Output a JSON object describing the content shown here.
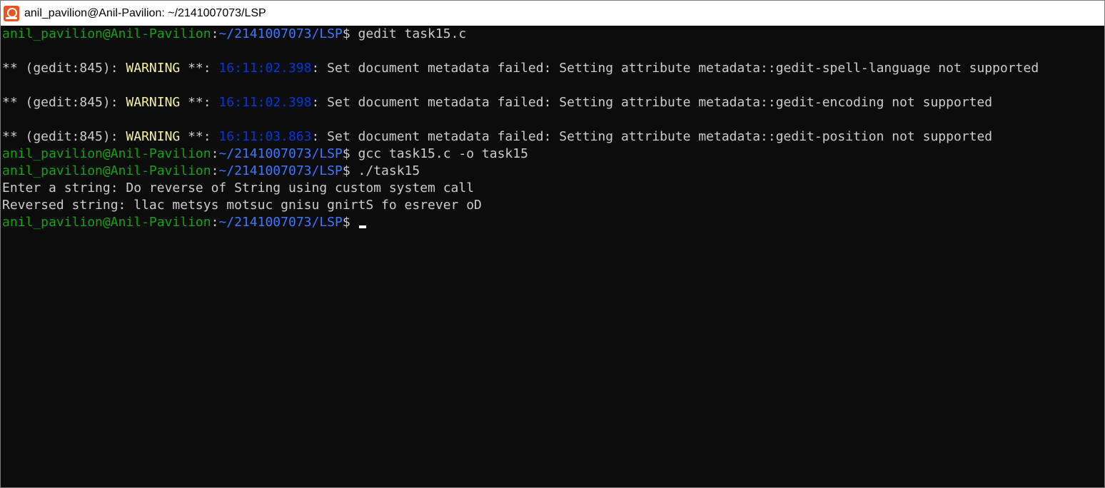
{
  "window": {
    "title": "anil_pavilion@Anil-Pavilion: ~/2141007073/LSP",
    "icon": "ubuntu-app-icon"
  },
  "prompt": {
    "user_host": "anil_pavilion@Anil-Pavilion",
    "colon": ":",
    "path": "~/2141007073/LSP",
    "dollar": "$"
  },
  "lines": {
    "cmd1": " gedit task15.c",
    "w1": {
      "prefix": "** (gedit:845): ",
      "level": "WARNING",
      "stars": " **: ",
      "time": "16:11:02.398",
      "msg": ": Set document metadata failed: Setting attribute metadata::gedit-spell-language not supported"
    },
    "w2": {
      "prefix": "** (gedit:845): ",
      "level": "WARNING",
      "stars": " **: ",
      "time": "16:11:02.398",
      "msg": ": Set document metadata failed: Setting attribute metadata::gedit-encoding not supported"
    },
    "w3": {
      "prefix": "** (gedit:845): ",
      "level": "WARNING",
      "stars": " **: ",
      "time": "16:11:03.863",
      "msg": ": Set document metadata failed: Setting attribute metadata::gedit-position not supported"
    },
    "cmd2": " gcc task15.c -o task15",
    "cmd3": " ./task15",
    "out1": "Enter a string: Do reverse of String using custom system call",
    "out2": "Reversed string: llac metsys motsuc gnisu gnirtS fo esrever oD",
    "cmd4": " "
  },
  "colors": {
    "background": "#0c0c0c",
    "text": "#cccccc",
    "user_host": "#13a10e",
    "path": "#3b78ff",
    "warning": "#f9f1a5",
    "timestamp": "#0037da",
    "icon": "#e95420"
  }
}
